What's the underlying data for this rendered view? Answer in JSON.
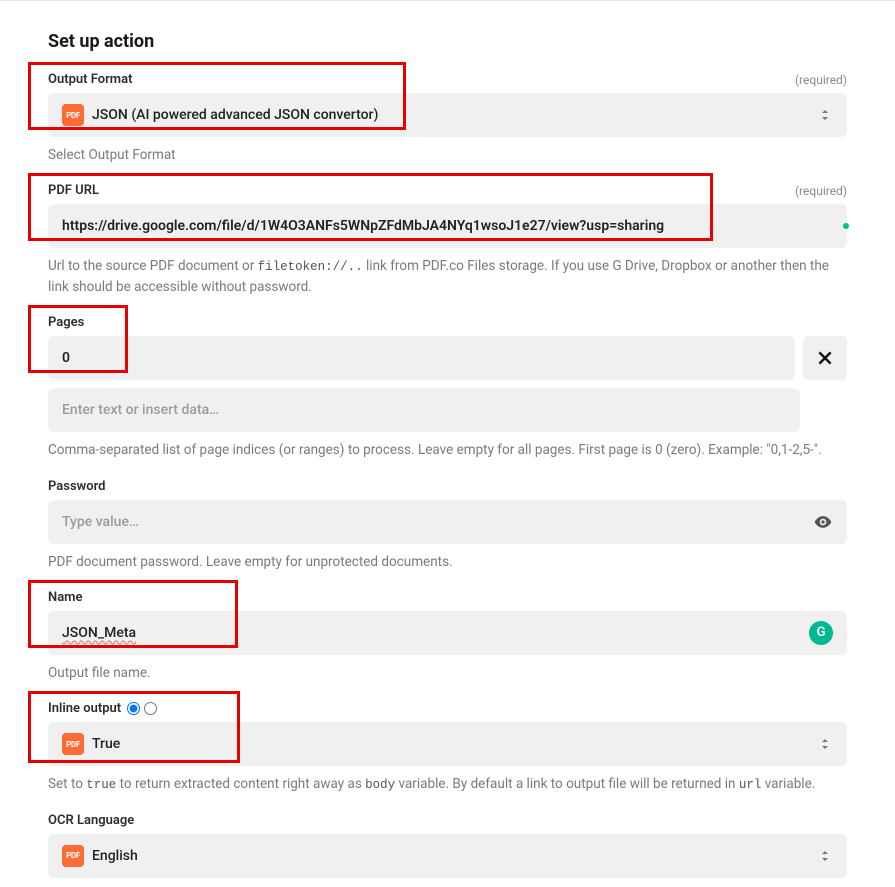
{
  "heading": "Set up action",
  "required_label": "(required)",
  "fields": {
    "output_format": {
      "label": "Output Format",
      "value": "JSON (AI powered advanced JSON convertor)",
      "hint": "Select Output Format",
      "icon": "PDF"
    },
    "pdf_url": {
      "label": "PDF URL",
      "value": "https://drive.google.com/file/d/1W4O3ANFs5WNpZFdMbJA4NYq1wsoJ1e27/view?usp=sharing",
      "hint_prefix": "Url to the source PDF document or ",
      "hint_code": "filetoken://..",
      "hint_suffix": " link from PDF.co Files storage. If you use G Drive, Dropbox or another then the link should be accessible without password."
    },
    "pages": {
      "label": "Pages",
      "value": "0",
      "placeholder": "Enter text or insert data…",
      "hint": "Comma-separated list of page indices (or ranges) to process. Leave empty for all pages. First page is 0 (zero). Example: \"0,1-2,5-\"."
    },
    "password": {
      "label": "Password",
      "placeholder": "Type value…",
      "hint": "PDF document password. Leave empty for unprotected documents."
    },
    "name": {
      "label": "Name",
      "value": "JSON_Meta",
      "hint": "Output file name."
    },
    "inline_output": {
      "label": "Inline output",
      "value": "True",
      "icon": "PDF",
      "hint_parts": [
        "Set to ",
        "true",
        " to return extracted content right away as ",
        "body",
        " variable. By default a link to output file will be returned in ",
        "url",
        " variable."
      ]
    },
    "ocr_language": {
      "label": "OCR Language",
      "value": "English",
      "icon": "PDF"
    }
  },
  "icons": {
    "g_badge": "G"
  }
}
